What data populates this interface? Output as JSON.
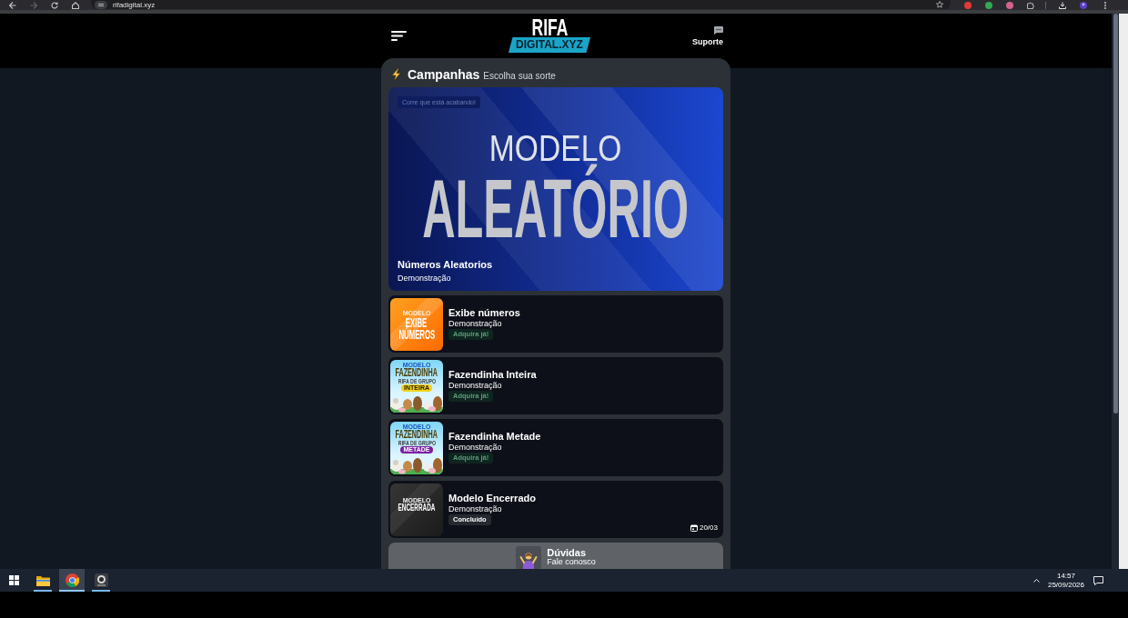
{
  "browser": {
    "nav_buttons": [
      {
        "kind": "back",
        "disabled": false
      },
      {
        "kind": "forward",
        "disabled": true
      },
      {
        "kind": "reload",
        "disabled": false
      },
      {
        "kind": "home",
        "disabled": false
      }
    ],
    "url": "rifadigital.xyz",
    "extensions": [
      {
        "color": "#e53935"
      },
      {
        "color": "#34a853"
      },
      {
        "color": "#d0648c"
      }
    ]
  },
  "header": {
    "logo_title": "RIFA",
    "logo_subtitle": "DIGITAL.XYZ",
    "support_label": "Suporte"
  },
  "section": {
    "title": "Campanhas",
    "subtitle": "Escolha sua sorte"
  },
  "featured": {
    "tag": "Corre que está acabando!",
    "image_lines": [
      {
        "kind": "light",
        "text": "MODELO"
      },
      {
        "kind": "heavy",
        "text": "ALEATÓRIO"
      }
    ],
    "title": "Números Aleatorios",
    "subtitle": "Demonstração"
  },
  "campaigns": [
    {
      "title": "Exibe números",
      "subtitle": "Demonstração",
      "badge": {
        "kind": "buy",
        "label": "Adquira já!"
      },
      "thumbnail": {
        "kind": "orange",
        "lines": [
          {
            "kind": "small",
            "text": "MODELO"
          },
          {
            "kind": "big",
            "text": "EXIBE"
          },
          {
            "kind": "big",
            "text": "NÚMEROS"
          }
        ]
      }
    },
    {
      "title": "Fazendinha Inteira",
      "subtitle": "Demonstração",
      "badge": {
        "kind": "buy",
        "label": "Adquira já!"
      },
      "thumbnail": {
        "kind": "farm",
        "color": "#f2d31b",
        "lines": [
          {
            "kind": "small",
            "text": "MODELO"
          },
          {
            "kind": "big",
            "text": "FAZENDINHA"
          },
          {
            "kind": "tiny",
            "text": "RIFA DE GRUPO"
          },
          {
            "kind": "band",
            "text": "INTEIRA"
          }
        ]
      }
    },
    {
      "title": "Fazendinha Metade",
      "subtitle": "Demonstração",
      "badge": {
        "kind": "buy",
        "label": "Adquira já!"
      },
      "thumbnail": {
        "kind": "farm",
        "color": "#7b1fa2",
        "lines": [
          {
            "kind": "small",
            "text": "MODELO"
          },
          {
            "kind": "big",
            "text": "FAZENDINHA"
          },
          {
            "kind": "tiny",
            "text": "RIFA DE GRUPO"
          },
          {
            "kind": "band",
            "text": "METADE"
          }
        ]
      }
    },
    {
      "title": "Modelo Encerrado",
      "subtitle": "Demonstração",
      "badge": {
        "kind": "done",
        "label": "Concluído"
      },
      "date": "20/03",
      "thumbnail": {
        "kind": "dark",
        "lines": [
          {
            "kind": "small",
            "text": "MODELO"
          },
          {
            "kind": "big",
            "text": "ENCERRADA"
          }
        ]
      }
    }
  ],
  "help": {
    "title": "Dúvidas",
    "subtitle": "Fale conosco"
  },
  "taskbar": {
    "apps": [
      {
        "kind": "folder",
        "running": true,
        "selected": false
      },
      {
        "kind": "browser",
        "running": true,
        "selected": true
      },
      {
        "kind": "lens",
        "running": true,
        "selected": false
      }
    ],
    "time": "14:57",
    "date": "25/09/2026"
  }
}
